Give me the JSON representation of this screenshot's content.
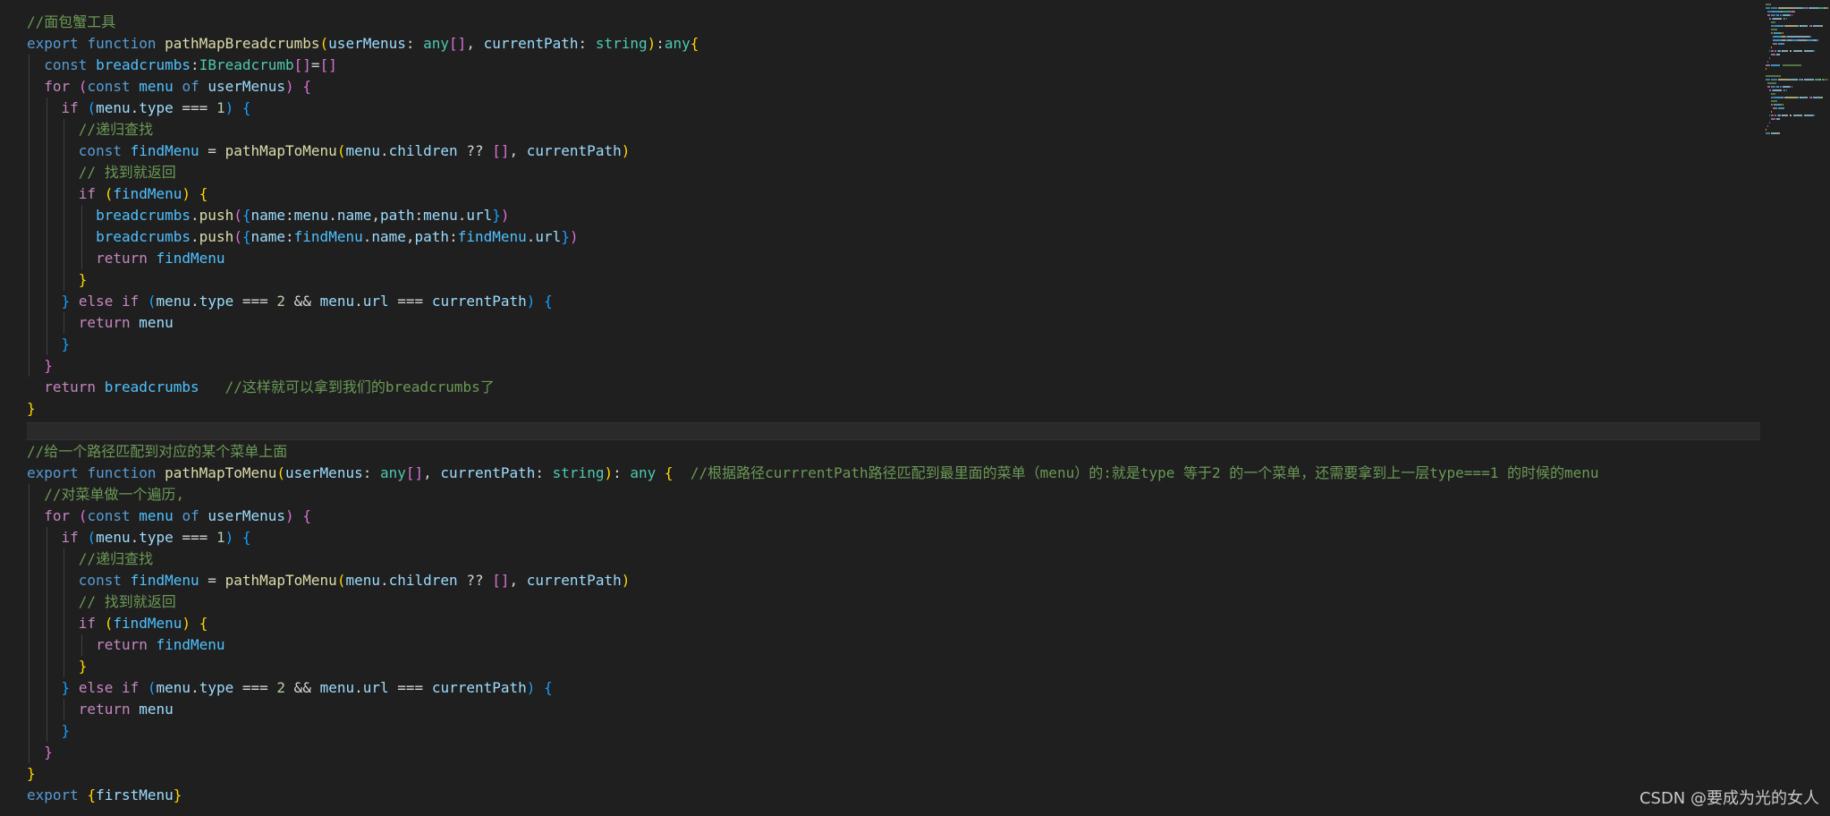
{
  "editor": {
    "language": "typescript",
    "theme": "dark",
    "colors": {
      "background": "#1f1f1f",
      "keyword": "#569cd6",
      "control": "#c586c0",
      "function": "#dcdcaa",
      "variable": "#9cdcfe",
      "constant": "#4fc1ff",
      "type": "#4ec9b0",
      "comment": "#6a9955",
      "number": "#b5cea8",
      "punctuation": "#d4d4d4",
      "bracket1": "#ffd700",
      "bracket2": "#da70d6",
      "bracket3": "#179fff"
    },
    "lines": [
      {
        "indent": 0,
        "tokens": [
          [
            "cmt",
            "//面包蟹工具"
          ]
        ]
      },
      {
        "indent": 0,
        "tokens": [
          [
            "kw",
            "export"
          ],
          [
            "p",
            " "
          ],
          [
            "kw",
            "function"
          ],
          [
            "p",
            " "
          ],
          [
            "fn",
            "pathMapBreadcrumbs"
          ],
          [
            "b1",
            "("
          ],
          [
            "var",
            "userMenus"
          ],
          [
            "p",
            ": "
          ],
          [
            "type",
            "any"
          ],
          [
            "b2",
            "[]"
          ],
          [
            "p",
            ", "
          ],
          [
            "var",
            "currentPath"
          ],
          [
            "p",
            ": "
          ],
          [
            "type",
            "string"
          ],
          [
            "b1",
            ")"
          ],
          [
            "p",
            ":"
          ],
          [
            "type",
            "any"
          ],
          [
            "b1",
            "{"
          ]
        ]
      },
      {
        "indent": 1,
        "tokens": [
          [
            "kw",
            "const"
          ],
          [
            "p",
            " "
          ],
          [
            "const",
            "breadcrumbs"
          ],
          [
            "p",
            ":"
          ],
          [
            "type",
            "IBreadcrumb"
          ],
          [
            "b2",
            "[]"
          ],
          [
            "p",
            "="
          ],
          [
            "b2",
            "[]"
          ]
        ]
      },
      {
        "indent": 1,
        "tokens": [
          [
            "ctl",
            "for"
          ],
          [
            "p",
            " "
          ],
          [
            "b2",
            "("
          ],
          [
            "kw",
            "const"
          ],
          [
            "p",
            " "
          ],
          [
            "const",
            "menu"
          ],
          [
            "p",
            " "
          ],
          [
            "kw",
            "of"
          ],
          [
            "p",
            " "
          ],
          [
            "var",
            "userMenus"
          ],
          [
            "b2",
            ")"
          ],
          [
            "p",
            " "
          ],
          [
            "b2",
            "{"
          ]
        ]
      },
      {
        "indent": 2,
        "tokens": [
          [
            "ctl",
            "if"
          ],
          [
            "p",
            " "
          ],
          [
            "b3",
            "("
          ],
          [
            "var",
            "menu"
          ],
          [
            "p",
            "."
          ],
          [
            "var",
            "type"
          ],
          [
            "p",
            " === "
          ],
          [
            "num",
            "1"
          ],
          [
            "b3",
            ")"
          ],
          [
            "p",
            " "
          ],
          [
            "b3",
            "{"
          ]
        ]
      },
      {
        "indent": 3,
        "tokens": [
          [
            "cmt",
            "//递归查找"
          ]
        ]
      },
      {
        "indent": 3,
        "tokens": [
          [
            "kw",
            "const"
          ],
          [
            "p",
            " "
          ],
          [
            "const",
            "findMenu"
          ],
          [
            "p",
            " = "
          ],
          [
            "fn",
            "pathMapToMenu"
          ],
          [
            "b1",
            "("
          ],
          [
            "var",
            "menu"
          ],
          [
            "p",
            "."
          ],
          [
            "var",
            "children"
          ],
          [
            "p",
            " ?? "
          ],
          [
            "b2",
            "[]"
          ],
          [
            "p",
            ", "
          ],
          [
            "var",
            "currentPath"
          ],
          [
            "b1",
            ")"
          ]
        ]
      },
      {
        "indent": 3,
        "tokens": [
          [
            "cmt",
            "// 找到就返回"
          ]
        ]
      },
      {
        "indent": 3,
        "tokens": [
          [
            "ctl",
            "if"
          ],
          [
            "p",
            " "
          ],
          [
            "b1",
            "("
          ],
          [
            "const",
            "findMenu"
          ],
          [
            "b1",
            ")"
          ],
          [
            "p",
            " "
          ],
          [
            "b1",
            "{"
          ]
        ]
      },
      {
        "indent": 4,
        "tokens": [
          [
            "const",
            "breadcrumbs"
          ],
          [
            "p",
            "."
          ],
          [
            "fn",
            "push"
          ],
          [
            "b2",
            "("
          ],
          [
            "b3",
            "{"
          ],
          [
            "var",
            "name"
          ],
          [
            "p",
            ":"
          ],
          [
            "var",
            "menu"
          ],
          [
            "p",
            "."
          ],
          [
            "var",
            "name"
          ],
          [
            "p",
            ","
          ],
          [
            "var",
            "path"
          ],
          [
            "p",
            ":"
          ],
          [
            "var",
            "menu"
          ],
          [
            "p",
            "."
          ],
          [
            "var",
            "url"
          ],
          [
            "b3",
            "}"
          ],
          [
            "b2",
            ")"
          ]
        ]
      },
      {
        "indent": 4,
        "tokens": [
          [
            "const",
            "breadcrumbs"
          ],
          [
            "p",
            "."
          ],
          [
            "fn",
            "push"
          ],
          [
            "b2",
            "("
          ],
          [
            "b3",
            "{"
          ],
          [
            "var",
            "name"
          ],
          [
            "p",
            ":"
          ],
          [
            "const",
            "findMenu"
          ],
          [
            "p",
            "."
          ],
          [
            "var",
            "name"
          ],
          [
            "p",
            ","
          ],
          [
            "var",
            "path"
          ],
          [
            "p",
            ":"
          ],
          [
            "const",
            "findMenu"
          ],
          [
            "p",
            "."
          ],
          [
            "var",
            "url"
          ],
          [
            "b3",
            "}"
          ],
          [
            "b2",
            ")"
          ]
        ]
      },
      {
        "indent": 4,
        "tokens": [
          [
            "ctl",
            "return"
          ],
          [
            "p",
            " "
          ],
          [
            "const",
            "findMenu"
          ]
        ]
      },
      {
        "indent": 3,
        "tokens": [
          [
            "b1",
            "}"
          ]
        ]
      },
      {
        "indent": 2,
        "tokens": [
          [
            "b3",
            "}"
          ],
          [
            "p",
            " "
          ],
          [
            "ctl",
            "else"
          ],
          [
            "p",
            " "
          ],
          [
            "ctl",
            "if"
          ],
          [
            "p",
            " "
          ],
          [
            "b3",
            "("
          ],
          [
            "var",
            "menu"
          ],
          [
            "p",
            "."
          ],
          [
            "var",
            "type"
          ],
          [
            "p",
            " === "
          ],
          [
            "num",
            "2"
          ],
          [
            "p",
            " && "
          ],
          [
            "var",
            "menu"
          ],
          [
            "p",
            "."
          ],
          [
            "var",
            "url"
          ],
          [
            "p",
            " === "
          ],
          [
            "var",
            "currentPath"
          ],
          [
            "b3",
            ")"
          ],
          [
            "p",
            " "
          ],
          [
            "b3",
            "{"
          ]
        ]
      },
      {
        "indent": 3,
        "tokens": [
          [
            "ctl",
            "return"
          ],
          [
            "p",
            " "
          ],
          [
            "var",
            "menu"
          ]
        ]
      },
      {
        "indent": 2,
        "tokens": [
          [
            "b3",
            "}"
          ]
        ]
      },
      {
        "indent": 1,
        "tokens": [
          [
            "b2",
            "}"
          ]
        ]
      },
      {
        "indent": 0,
        "lead": "  ",
        "tokens": [
          [
            "ctl",
            "return"
          ],
          [
            "p",
            " "
          ],
          [
            "const",
            "breadcrumbs"
          ],
          [
            "p",
            "   "
          ],
          [
            "cmt",
            "//这样就可以拿到我们的breadcrumbs了"
          ]
        ]
      },
      {
        "indent": 0,
        "tokens": [
          [
            "b1",
            "}"
          ]
        ]
      },
      {
        "indent": 0,
        "separator": true,
        "tokens": []
      },
      {
        "indent": 0,
        "tokens": [
          [
            "cmt",
            "//给一个路径匹配到对应的某个菜单上面"
          ]
        ]
      },
      {
        "indent": 0,
        "tokens": [
          [
            "kw",
            "export"
          ],
          [
            "p",
            " "
          ],
          [
            "kw",
            "function"
          ],
          [
            "p",
            " "
          ],
          [
            "fn",
            "pathMapToMenu"
          ],
          [
            "b1",
            "("
          ],
          [
            "var",
            "userMenus"
          ],
          [
            "p",
            ": "
          ],
          [
            "type",
            "any"
          ],
          [
            "b2",
            "[]"
          ],
          [
            "p",
            ", "
          ],
          [
            "var",
            "currentPath"
          ],
          [
            "p",
            ": "
          ],
          [
            "type",
            "string"
          ],
          [
            "b1",
            ")"
          ],
          [
            "p",
            ": "
          ],
          [
            "type",
            "any"
          ],
          [
            "p",
            " "
          ],
          [
            "b1",
            "{"
          ],
          [
            "p",
            "  "
          ],
          [
            "cmt",
            "//根据路径currrentPath路径匹配到最里面的菜单（menu）的:就是type 等于2 的一个菜单，还需要拿到上一层type===1 的时候的menu"
          ]
        ]
      },
      {
        "indent": 1,
        "tokens": [
          [
            "cmt",
            "//对菜单做一个遍历,"
          ]
        ]
      },
      {
        "indent": 1,
        "tokens": [
          [
            "ctl",
            "for"
          ],
          [
            "p",
            " "
          ],
          [
            "b2",
            "("
          ],
          [
            "kw",
            "const"
          ],
          [
            "p",
            " "
          ],
          [
            "const",
            "menu"
          ],
          [
            "p",
            " "
          ],
          [
            "kw",
            "of"
          ],
          [
            "p",
            " "
          ],
          [
            "var",
            "userMenus"
          ],
          [
            "b2",
            ")"
          ],
          [
            "p",
            " "
          ],
          [
            "b2",
            "{"
          ]
        ]
      },
      {
        "indent": 2,
        "tokens": [
          [
            "ctl",
            "if"
          ],
          [
            "p",
            " "
          ],
          [
            "b3",
            "("
          ],
          [
            "var",
            "menu"
          ],
          [
            "p",
            "."
          ],
          [
            "var",
            "type"
          ],
          [
            "p",
            " === "
          ],
          [
            "num",
            "1"
          ],
          [
            "b3",
            ")"
          ],
          [
            "p",
            " "
          ],
          [
            "b3",
            "{"
          ]
        ]
      },
      {
        "indent": 3,
        "tokens": [
          [
            "cmt",
            "//递归查找"
          ]
        ]
      },
      {
        "indent": 3,
        "tokens": [
          [
            "kw",
            "const"
          ],
          [
            "p",
            " "
          ],
          [
            "const",
            "findMenu"
          ],
          [
            "p",
            " = "
          ],
          [
            "fn",
            "pathMapToMenu"
          ],
          [
            "b1",
            "("
          ],
          [
            "var",
            "menu"
          ],
          [
            "p",
            "."
          ],
          [
            "var",
            "children"
          ],
          [
            "p",
            " ?? "
          ],
          [
            "b2",
            "[]"
          ],
          [
            "p",
            ", "
          ],
          [
            "var",
            "currentPath"
          ],
          [
            "b1",
            ")"
          ]
        ]
      },
      {
        "indent": 3,
        "tokens": [
          [
            "cmt",
            "// 找到就返回"
          ]
        ]
      },
      {
        "indent": 3,
        "tokens": [
          [
            "ctl",
            "if"
          ],
          [
            "p",
            " "
          ],
          [
            "b1",
            "("
          ],
          [
            "const",
            "findMenu"
          ],
          [
            "b1",
            ")"
          ],
          [
            "p",
            " "
          ],
          [
            "b1",
            "{"
          ]
        ]
      },
      {
        "indent": 4,
        "tokens": [
          [
            "ctl",
            "return"
          ],
          [
            "p",
            " "
          ],
          [
            "const",
            "findMenu"
          ]
        ]
      },
      {
        "indent": 3,
        "tokens": [
          [
            "b1",
            "}"
          ]
        ]
      },
      {
        "indent": 2,
        "tokens": [
          [
            "b3",
            "}"
          ],
          [
            "p",
            " "
          ],
          [
            "ctl",
            "else"
          ],
          [
            "p",
            " "
          ],
          [
            "ctl",
            "if"
          ],
          [
            "p",
            " "
          ],
          [
            "b3",
            "("
          ],
          [
            "var",
            "menu"
          ],
          [
            "p",
            "."
          ],
          [
            "var",
            "type"
          ],
          [
            "p",
            " === "
          ],
          [
            "num",
            "2"
          ],
          [
            "p",
            " && "
          ],
          [
            "var",
            "menu"
          ],
          [
            "p",
            "."
          ],
          [
            "var",
            "url"
          ],
          [
            "p",
            " === "
          ],
          [
            "var",
            "currentPath"
          ],
          [
            "b3",
            ")"
          ],
          [
            "p",
            " "
          ],
          [
            "b3",
            "{"
          ]
        ]
      },
      {
        "indent": 3,
        "tokens": [
          [
            "ctl",
            "return"
          ],
          [
            "p",
            " "
          ],
          [
            "var",
            "menu"
          ]
        ]
      },
      {
        "indent": 2,
        "tokens": [
          [
            "b3",
            "}"
          ]
        ]
      },
      {
        "indent": 1,
        "tokens": [
          [
            "b2",
            "}"
          ]
        ]
      },
      {
        "indent": 0,
        "tokens": [
          [
            "b1",
            "}"
          ]
        ]
      },
      {
        "indent": 0,
        "tokens": [
          [
            "kw",
            "export"
          ],
          [
            "p",
            " "
          ],
          [
            "b1",
            "{"
          ],
          [
            "var",
            "firstMenu"
          ],
          [
            "b1",
            "}"
          ]
        ]
      }
    ]
  },
  "watermark": {
    "text": "CSDN @要成为光的女人"
  }
}
